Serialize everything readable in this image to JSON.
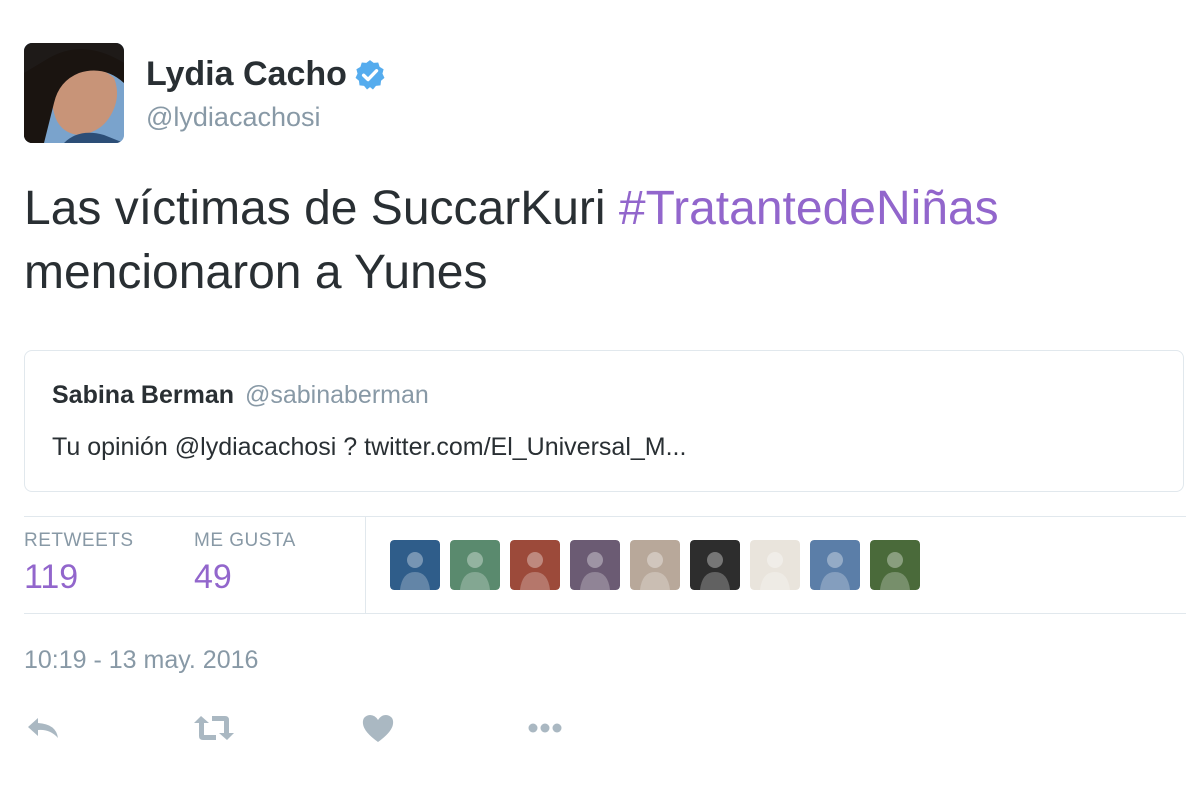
{
  "author": {
    "name": "Lydia Cacho",
    "handle": "@lydiacachosi",
    "verified": true,
    "avatar_icon": "profile-photo"
  },
  "tweet": {
    "text_before": "Las víctimas de SuccarKuri ",
    "hashtag": "#TratantedeNiñas",
    "text_after": "mencionaron a Yunes"
  },
  "quoted_tweet": {
    "name": "Sabina Berman",
    "handle": "@sabinaberman",
    "text": "Tu opinión @lydiacachosi ? twitter.com/El_Universal_M..."
  },
  "stats": {
    "retweets_label": "RETWEETS",
    "retweets_value": "119",
    "likes_label": "ME GUSTA",
    "likes_value": "49"
  },
  "likers": [
    {
      "icon": "liker-avatar",
      "color": "#2f5d8a"
    },
    {
      "icon": "liker-avatar",
      "color": "#5a8a6e"
    },
    {
      "icon": "liker-avatar",
      "color": "#9c4a3a"
    },
    {
      "icon": "liker-avatar",
      "color": "#6b5b73"
    },
    {
      "icon": "liker-avatar",
      "color": "#b8a89a"
    },
    {
      "icon": "liker-avatar",
      "color": "#2d2d2d"
    },
    {
      "icon": "liker-avatar",
      "color": "#e9e4dc"
    },
    {
      "icon": "liker-avatar",
      "color": "#5b7ea8"
    },
    {
      "icon": "liker-avatar",
      "color": "#4a6a3a"
    }
  ],
  "timestamp": "10:19 - 13 may. 2016",
  "actions": [
    "reply-icon",
    "retweet-icon",
    "like-icon",
    "more-icon"
  ],
  "colors": {
    "hashtag": "#9266cc",
    "stat_value": "#9266cc",
    "verified": "#55acee",
    "muted": "#8899a6",
    "action_icon": "#aab8c2"
  }
}
